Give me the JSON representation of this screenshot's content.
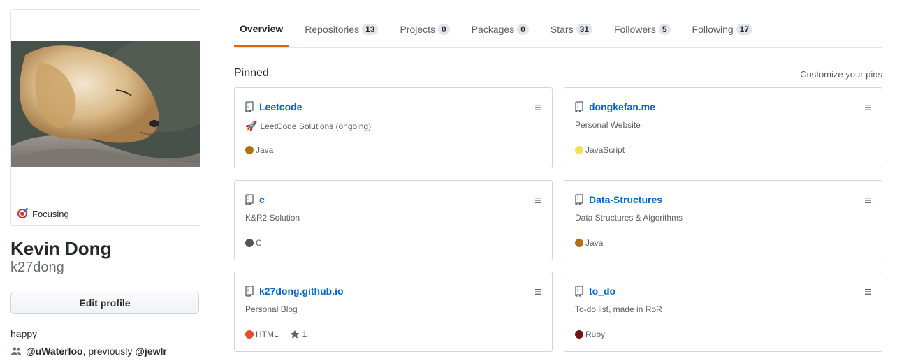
{
  "profile": {
    "status_text": "Focusing",
    "full_name": "Kevin Dong",
    "username": "k27dong",
    "edit_button": "Edit profile",
    "bio": "happy",
    "org_text_1": "@uWaterloo",
    "org_text_2": ", previously ",
    "org_text_3": "@jewlr"
  },
  "tabs": [
    {
      "label": "Overview",
      "count": ""
    },
    {
      "label": "Repositories",
      "count": "13"
    },
    {
      "label": "Projects",
      "count": "0"
    },
    {
      "label": "Packages",
      "count": "0"
    },
    {
      "label": "Stars",
      "count": "31"
    },
    {
      "label": "Followers",
      "count": "5"
    },
    {
      "label": "Following",
      "count": "17"
    }
  ],
  "pinned": {
    "title": "Pinned",
    "customize": "Customize your pins",
    "repos": [
      {
        "name": "Leetcode",
        "emoji": "🚀",
        "description": "LeetCode Solutions (ongoing)",
        "language": "Java",
        "color": "#b07219",
        "stars": ""
      },
      {
        "name": "dongkefan.me",
        "emoji": "",
        "description": "Personal Website",
        "language": "JavaScript",
        "color": "#f1e05a",
        "stars": ""
      },
      {
        "name": "c",
        "emoji": "",
        "description": "K&R2 Solution",
        "language": "C",
        "color": "#555555",
        "stars": ""
      },
      {
        "name": "Data-Structures",
        "emoji": "",
        "description": "Data Structures & Algorithms",
        "language": "Java",
        "color": "#b07219",
        "stars": ""
      },
      {
        "name": "k27dong.github.io",
        "emoji": "",
        "description": "Personal Blog",
        "language": "HTML",
        "color": "#e34c26",
        "stars": "1"
      },
      {
        "name": "to_do",
        "emoji": "",
        "description": "To-do list, made in RoR",
        "language": "Ruby",
        "color": "#701516",
        "stars": ""
      }
    ]
  },
  "colors": {
    "accent_tab": "#e36209",
    "link": "#0366d6"
  },
  "icons": [
    "repo-icon",
    "grabber-icon",
    "star-icon",
    "people-icon",
    "target-icon"
  ]
}
